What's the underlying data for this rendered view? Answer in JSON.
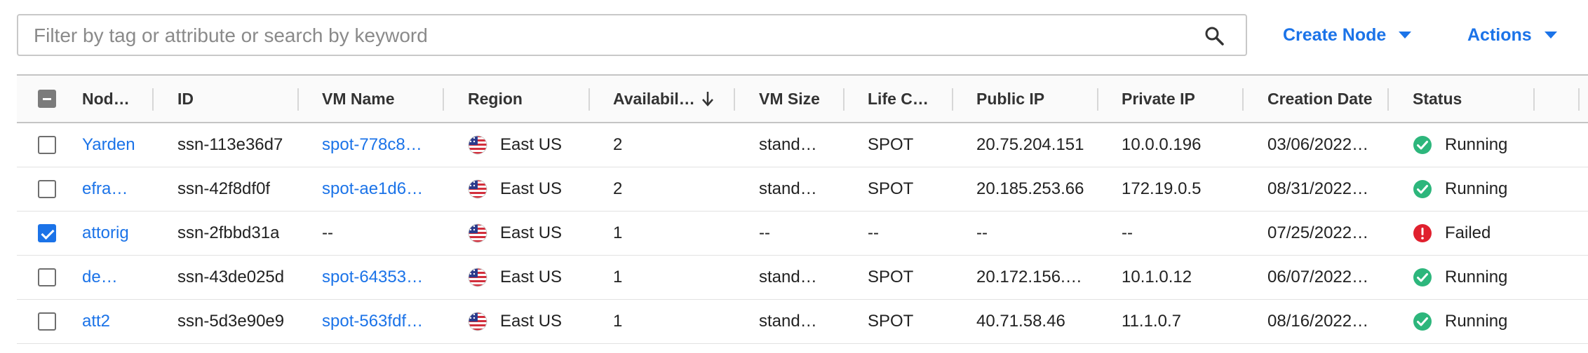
{
  "search": {
    "placeholder": "Filter by tag or attribute or search by keyword",
    "value": ""
  },
  "toolbar": {
    "create_label": "Create Node",
    "actions_label": "Actions"
  },
  "columns": [
    "Nod…",
    "ID",
    "VM Name",
    "Region",
    "Availabil…",
    "VM Size",
    "Life C…",
    "Public IP",
    "Private IP",
    "Creation Date",
    "Status"
  ],
  "sort": {
    "column": "Availabil…",
    "direction": "descending"
  },
  "rows": [
    {
      "checked": false,
      "name": "Yarden",
      "id": "ssn-113e36d7",
      "vm_name": "spot-778c8…",
      "region": "East US",
      "availability": "2",
      "vm_size": "stand…",
      "lifecycle": "SPOT",
      "public_ip": "20.75.204.151",
      "private_ip": "10.0.0.196",
      "creation_date": "03/06/2022…",
      "status": "Running"
    },
    {
      "checked": false,
      "name": "efra…",
      "id": "ssn-42f8df0f",
      "vm_name": "spot-ae1d6…",
      "region": "East US",
      "availability": "2",
      "vm_size": "stand…",
      "lifecycle": "SPOT",
      "public_ip": "20.185.253.66",
      "private_ip": "172.19.0.5",
      "creation_date": "08/31/2022…",
      "status": "Running"
    },
    {
      "checked": true,
      "name": "attorig",
      "id": "ssn-2fbbd31a",
      "vm_name": "--",
      "region": "East US",
      "availability": "1",
      "vm_size": "--",
      "lifecycle": "--",
      "public_ip": "--",
      "private_ip": "--",
      "creation_date": "07/25/2022…",
      "status": "Failed"
    },
    {
      "checked": false,
      "name": "de…",
      "id": "ssn-43de025d",
      "vm_name": "spot-64353…",
      "region": "East US",
      "availability": "1",
      "vm_size": "stand…",
      "lifecycle": "SPOT",
      "public_ip": "20.172.156.…",
      "private_ip": "10.1.0.12",
      "creation_date": "06/07/2022…",
      "status": "Running"
    },
    {
      "checked": false,
      "name": "att2",
      "id": "ssn-5d3e90e9",
      "vm_name": "spot-563fdf…",
      "region": "East US",
      "availability": "1",
      "vm_size": "stand…",
      "lifecycle": "SPOT",
      "public_ip": "40.71.58.46",
      "private_ip": "11.1.0.7",
      "creation_date": "08/16/2022…",
      "status": "Running"
    }
  ],
  "colors": {
    "accent": "#1b73e8",
    "running": "#2db67c",
    "failed": "#e0202e"
  },
  "icons": {
    "search": "search-icon",
    "region_flag": "us-flag-icon",
    "running": "check-circle-icon",
    "failed": "alert-circle-icon"
  }
}
